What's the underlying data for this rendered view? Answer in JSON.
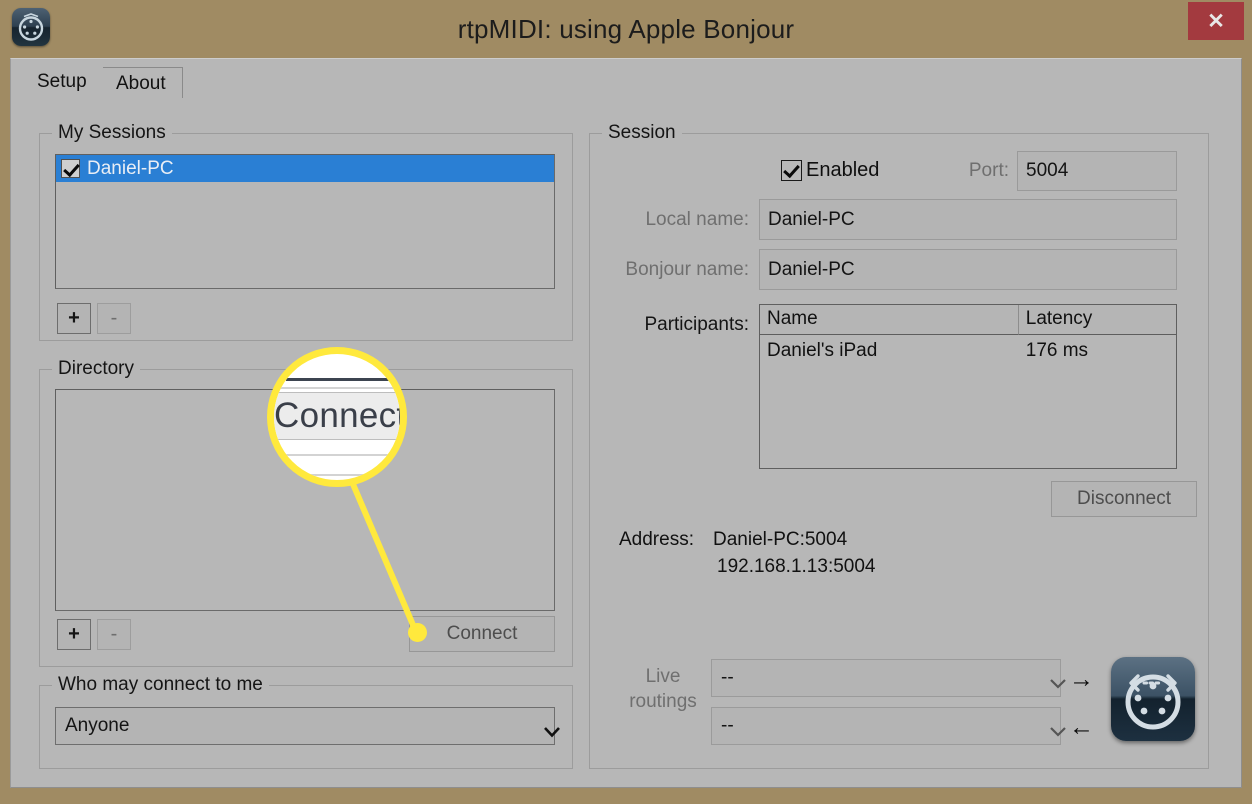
{
  "window": {
    "title": "rtpMIDI: using Apple Bonjour",
    "app_icon": "midi-din-icon",
    "close_label": "✕",
    "frame_color": "#a08b63",
    "client_color": "#b7b7b7"
  },
  "tabs": [
    {
      "label": "Setup",
      "active": true
    },
    {
      "label": "About",
      "active": false
    }
  ],
  "my_sessions": {
    "group_label": "My Sessions",
    "rows": [
      {
        "label": "Daniel-PC",
        "checked": true,
        "selected": true
      }
    ],
    "add_button": "+",
    "remove_button": "-",
    "selection_color": "#2a7fd4"
  },
  "directory": {
    "group_label": "Directory",
    "rows": [],
    "add_button": "+",
    "remove_button": "-",
    "connect_button": "Connect"
  },
  "who_may_connect": {
    "group_label": "Who may connect to me",
    "selected": "Anyone"
  },
  "session": {
    "group_label": "Session",
    "enabled_label": "Enabled",
    "enabled_checked": true,
    "port_label": "Port:",
    "port_value": "5004",
    "local_name_label": "Local name:",
    "local_name_value": "Daniel-PC",
    "bonjour_name_label": "Bonjour name:",
    "bonjour_name_value": "Daniel-PC",
    "participants_label": "Participants:",
    "participants_columns": [
      "Name",
      "Latency"
    ],
    "participants_rows": [
      {
        "name": "Daniel's iPad",
        "latency": "176 ms"
      }
    ],
    "disconnect_button": "Disconnect",
    "address_label": "Address:",
    "address_lines": [
      "Daniel-PC:5004",
      "192.168.1.13:5004"
    ],
    "live_routings_label_line1": "Live",
    "live_routings_label_line2": "routings",
    "routing_out_value": "--",
    "routing_in_value": "--",
    "routing_out_arrow": "→",
    "routing_in_arrow": "←",
    "midi_logo": "midi-din-logo"
  },
  "callout": {
    "magnified_text": "Connect",
    "highlight_color": "#ffe93d"
  }
}
